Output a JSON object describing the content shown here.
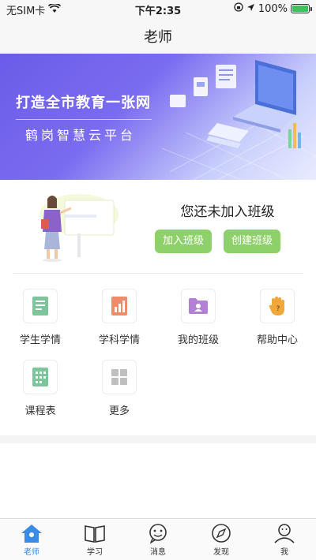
{
  "status_bar": {
    "carrier": "无SIM卡",
    "time": "下午2:35",
    "battery": "100%",
    "battery_level": 1.0,
    "icons": [
      "wifi-icon",
      "orientation-lock-icon",
      "location-icon",
      "battery-icon"
    ]
  },
  "nav": {
    "title": "老师"
  },
  "banner": {
    "title": "打造全市教育一张网",
    "subtitle": "鹤岗智慧云平台",
    "page_count": 1,
    "active_page": 1
  },
  "class_card": {
    "message": "您还未加入班级",
    "join_label": "加入班级",
    "create_label": "创建班级"
  },
  "grid": [
    {
      "label": "学生学情",
      "icon": "student-report-icon",
      "color": "#7cc49a"
    },
    {
      "label": "学科学情",
      "icon": "subject-chart-icon",
      "color": "#ef8b6a"
    },
    {
      "label": "我的班级",
      "icon": "class-folder-icon",
      "color": "#b47fd6"
    },
    {
      "label": "帮助中心",
      "icon": "help-hand-icon",
      "color": "#f0a83a"
    },
    {
      "label": "课程表",
      "icon": "schedule-icon",
      "color": "#7cc49a"
    },
    {
      "label": "更多",
      "icon": "more-grid-icon",
      "color": "#bfbfbf"
    }
  ],
  "tabs": [
    {
      "label": "老师",
      "icon": "home-icon",
      "active": true
    },
    {
      "label": "学习",
      "icon": "book-icon",
      "active": false
    },
    {
      "label": "消息",
      "icon": "message-icon",
      "active": false
    },
    {
      "label": "发现",
      "icon": "compass-icon",
      "active": false
    },
    {
      "label": "我",
      "icon": "profile-icon",
      "active": false
    }
  ],
  "colors": {
    "accent": "#3b8be6",
    "button": "#8ed16a",
    "banner": "#6b5ce8"
  }
}
